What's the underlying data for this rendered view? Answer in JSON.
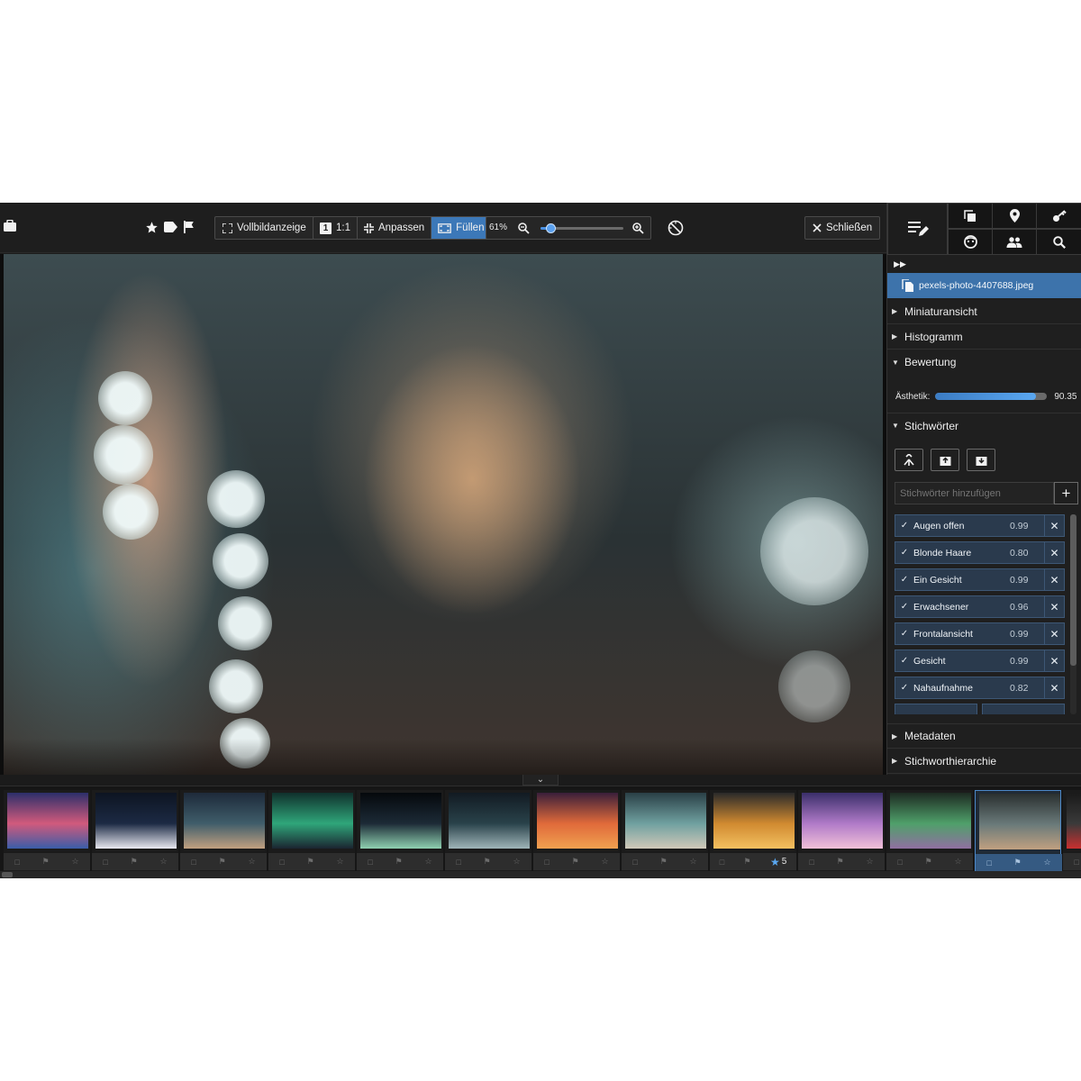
{
  "toolbar": {
    "fullscreen_label": "Vollbildanzeige",
    "one_to_one_label": "1:1",
    "one_icon_text": "1",
    "fit_label": "Anpassen",
    "fill_label": "Füllen",
    "zoom_percent": "61%",
    "zoom_level": 0.12,
    "close_label": "Schließen"
  },
  "sidebar": {
    "file_name": "pexels-photo-4407688.jpeg",
    "sections": {
      "thumbnail": "Miniaturansicht",
      "histogram": "Histogramm",
      "rating": "Bewertung",
      "keywords": "Stichwörter",
      "metadata": "Metadaten",
      "hierarchy": "Stichworthierarchie"
    },
    "aesthetic_label": "Ästhetik:",
    "aesthetic_value": "90.35",
    "aesthetic_fraction": 0.9035,
    "keyword_placeholder": "Stichwörter hinzufügen",
    "keywords": [
      {
        "label": "Augen offen",
        "score": "0.99"
      },
      {
        "label": "Blonde Haare",
        "score": "0.80"
      },
      {
        "label": "Ein Gesicht",
        "score": "0.99"
      },
      {
        "label": "Erwachsener",
        "score": "0.96"
      },
      {
        "label": "Frontalansicht",
        "score": "0.99"
      },
      {
        "label": "Gesicht",
        "score": "0.99"
      },
      {
        "label": "Nahaufnahme",
        "score": "0.82"
      }
    ]
  },
  "filmstrip": {
    "selected_index": 11,
    "rated_star_count": "5",
    "thumbnails": [
      {
        "colors": [
          "#2c2f6a",
          "#d15a7c",
          "#3a5da8"
        ]
      },
      {
        "colors": [
          "#0d1421",
          "#1c2a44",
          "#e8e8f0"
        ]
      },
      {
        "colors": [
          "#1e2a3a",
          "#3f5d6a",
          "#c0a080"
        ]
      },
      {
        "colors": [
          "#10302c",
          "#2fa67a",
          "#1b2530"
        ]
      },
      {
        "colors": [
          "#05080c",
          "#1c2a36",
          "#8fd0b0"
        ]
      },
      {
        "colors": [
          "#121a22",
          "#29424a",
          "#9fb4b8"
        ]
      },
      {
        "colors": [
          "#3a1f3a",
          "#e06a3a",
          "#f0a050"
        ]
      },
      {
        "colors": [
          "#2a3f46",
          "#6fa0a0",
          "#d0c8b8"
        ]
      },
      {
        "colors": [
          "#2a2a2a",
          "#d08a30",
          "#f3c060"
        ]
      },
      {
        "colors": [
          "#3a2f6a",
          "#b07ac8",
          "#f0c0d8"
        ]
      },
      {
        "colors": [
          "#1d2a22",
          "#4fa06a",
          "#9070a0"
        ]
      },
      {
        "colors": [
          "#2a3030",
          "#6a7a7a",
          "#c0a080"
        ]
      },
      {
        "colors": [
          "#1a1a1a",
          "#3a3a3a",
          "#c83030"
        ]
      }
    ]
  }
}
